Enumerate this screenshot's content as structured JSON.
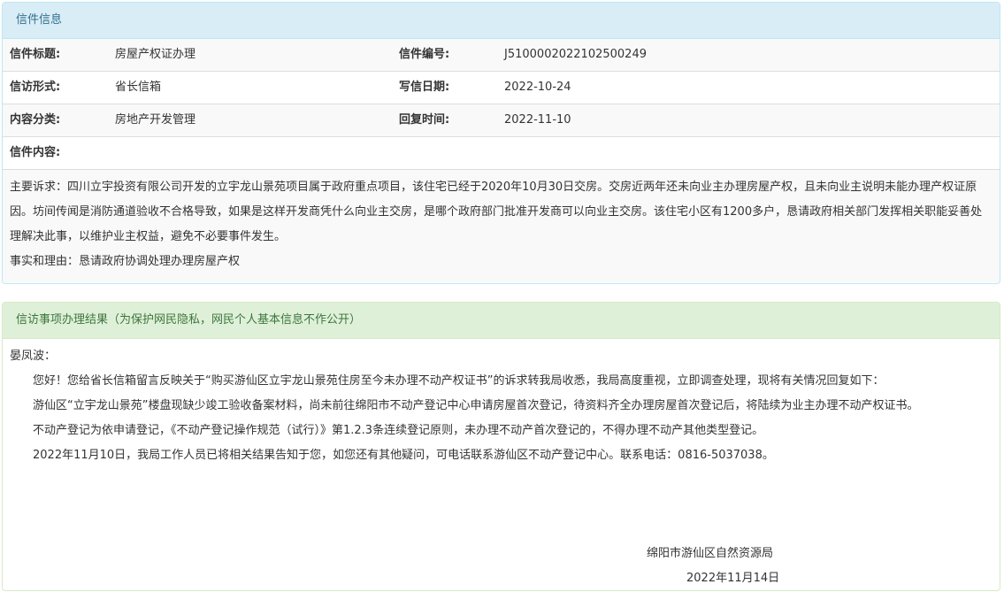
{
  "letter_panel": {
    "heading": "信件信息",
    "rows": [
      {
        "label1": "信件标题:",
        "value1": "房屋产权证办理",
        "label2": "信件编号:",
        "value2": "J5100002022102500249"
      },
      {
        "label1": "信访形式:",
        "value1": "省长信箱",
        "label2": "写信日期:",
        "value2": "2022-10-24"
      },
      {
        "label1": "内容分类:",
        "value1": "房地产开发管理",
        "label2": "回复时间:",
        "value2": "2022-11-10"
      }
    ],
    "content_label": "信件内容:",
    "content_paragraphs": [
      "主要诉求：四川立宇投资有限公司开发的立宇龙山景苑项目属于政府重点项目，该住宅已经于2020年10月30日交房。交房近两年还未向业主办理房屋产权，且未向业主说明未能办理产权证原因。坊间传闻是消防通道验收不合格导致，如果是这样开发商凭什么向业主交房，是哪个政府部门批准开发商可以向业主交房。该住宅小区有1200多户，恳请政府相关部门发挥相关职能妥善处理解决此事，以维护业主权益，避免不必要事件发生。",
      "事实和理由：恳请政府协调处理办理房屋产权"
    ]
  },
  "result_panel": {
    "heading": "信访事项办理结果（为保护网民隐私，网民个人基本信息不作公开）",
    "salutation": "晏凤波：",
    "paragraphs": [
      "您好！您给省长信箱留言反映关于“购买游仙区立宇龙山景苑住房至今未办理不动产权证书”的诉求转我局收悉，我局高度重视，立即调查处理，现将有关情况回复如下：",
      "游仙区“立宇龙山景苑”楼盘现缺少竣工验收备案材料，尚未前往绵阳市不动产登记中心申请房屋首次登记，待资料齐全办理房屋首次登记后，将陆续为业主办理不动产权证书。",
      "不动产登记为依申请登记，《不动产登记操作规范（试行）》第1.2.3条连续登记原则，未办理不动产首次登记的，不得办理不动产其他类型登记。",
      "2022年11月10日，我局工作人员已将相关结果告知于您，如您还有其他疑问，可电话联系游仙区不动产登记中心。联系电话：0816-5037038。"
    ],
    "signature_org": "绵阳市游仙区自然资源局",
    "signature_date": "2022年11月14日"
  }
}
